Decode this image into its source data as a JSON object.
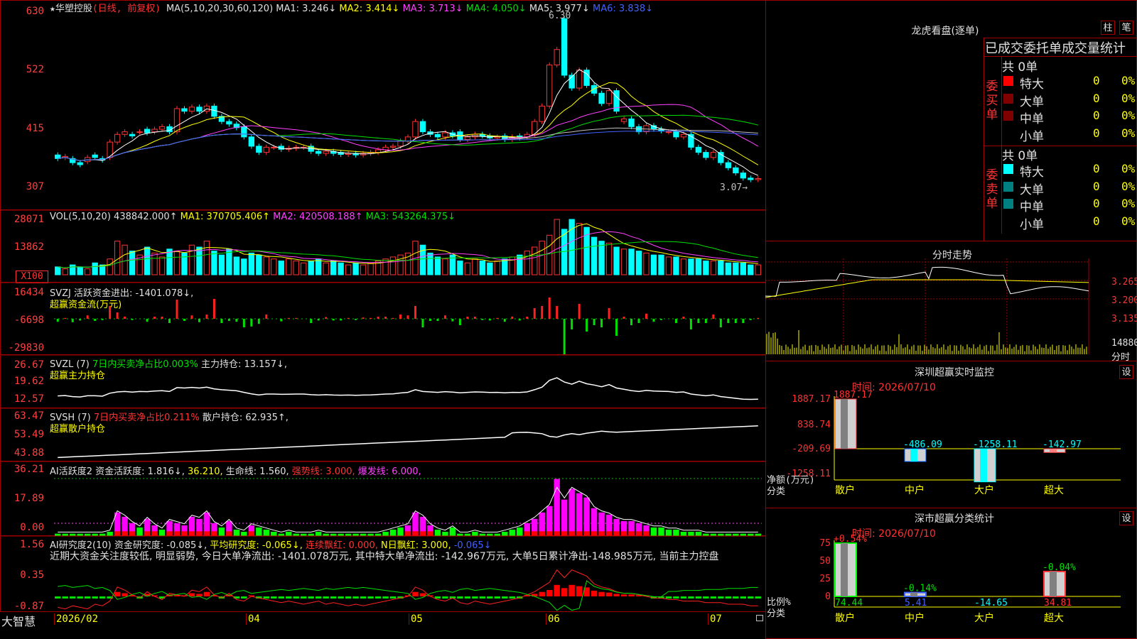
{
  "stock": {
    "title": "★华塑控股",
    "mode": "(日线, 前复权)",
    "ma_header": [
      {
        "t": "MA(5,10,20,30,60,120)",
        "c": "white"
      },
      {
        "t": "MA1: 3.246↓",
        "c": "white"
      },
      {
        "t": "MA2: 3.414↓",
        "c": "yel"
      },
      {
        "t": "MA3: 3.713↓",
        "c": "mag"
      },
      {
        "t": "MA4: 4.050↓",
        "c": "grn"
      },
      {
        "t": "MA5: 3.977↓",
        "c": "white"
      },
      {
        "t": "MA6: 3.838↓",
        "c": "blu"
      }
    ],
    "price_axis": [
      "630",
      "522",
      "415",
      "307"
    ],
    "peak_label": "6.30",
    "last_label": "3.07→"
  },
  "vol": {
    "header": [
      {
        "t": "VOL(5,10,20)",
        "c": "white"
      },
      {
        "t": "438842.000↑",
        "c": "white"
      },
      {
        "t": "MA1: 370705.406↑",
        "c": "yel"
      },
      {
        "t": "MA2: 420508.188↑",
        "c": "mag"
      },
      {
        "t": "MA3: 543264.375↓",
        "c": "grn"
      }
    ],
    "axis": [
      "28071",
      "13862"
    ],
    "unit": "X100"
  },
  "svzj": {
    "header": [
      {
        "t": "SVZJ  活跃资金进出: -1401.078↓,",
        "c": "white"
      }
    ],
    "sub": "超赢资金流(万元)",
    "axis": [
      "16434",
      "-6698",
      "-29830"
    ]
  },
  "svzl": {
    "header": [
      {
        "t": "SVZL (7)",
        "c": "white"
      },
      {
        "t": "7日内买卖净占比0.003%",
        "c": "grn"
      },
      {
        "t": "主力持仓: 13.157↓,",
        "c": "white"
      }
    ],
    "sub": "超赢主力持仓",
    "axis": [
      "26.67",
      "19.62",
      "12.57"
    ]
  },
  "svsh": {
    "header": [
      {
        "t": "SVSH (7)",
        "c": "white"
      },
      {
        "t": "7日内买卖净占比0.211%",
        "c": "red"
      },
      {
        "t": "散户持仓: 62.935↑,",
        "c": "white"
      }
    ],
    "sub": "超赢散户持仓",
    "axis": [
      "63.47",
      "53.49",
      "43.88"
    ]
  },
  "ai1": {
    "header": [
      {
        "t": "AI活跃度2",
        "c": "white"
      },
      {
        "t": "资金活跃度: 1.816↓,",
        "c": "white"
      },
      {
        "t": "36.210,",
        "c": "yel"
      },
      {
        "t": "生命线: 1.560,",
        "c": "white"
      },
      {
        "t": "强势线: 3.000,",
        "c": "red"
      },
      {
        "t": "爆发线: 6.000,",
        "c": "mag"
      }
    ],
    "axis": [
      "36.21",
      "17.89",
      "0.00"
    ]
  },
  "ai2": {
    "header": [
      {
        "t": "AI研究度2(10)",
        "c": "white"
      },
      {
        "t": "资金研究度: -0.085↓,",
        "c": "white"
      },
      {
        "t": "平均研究度: -0.065↓,",
        "c": "yel"
      },
      {
        "t": "连续飘红: 0.000,",
        "c": "red"
      },
      {
        "t": "N日飘红: 3.000,",
        "c": "yel"
      },
      {
        "t": "-0.065↓",
        "c": "blu"
      }
    ],
    "note": "近期大资金关注度较低, 明显弱势, 今日大单净流出: -1401.078万元, 其中特大单净流出: -142.967万元, 大单5日累计净出-148.985万元, 当前主力控盘",
    "axis": [
      "1.56",
      "0.35",
      "-0.87"
    ]
  },
  "date_axis": [
    "2026/02",
    "04",
    "05",
    "06",
    "07"
  ],
  "brand": "大智慧",
  "right": {
    "lhb_title": "龙虎看盘(逐单)",
    "btn_zhu": "柱",
    "btn_bi": "笔",
    "stat_title": "已成交委托单成交量统计",
    "buy_label": "委买单",
    "sell_label": "委卖单",
    "buy_total": "共 0单",
    "sell_total": "共 0单",
    "rows": [
      {
        "name": "特大",
        "val": "0",
        "pct": "0%"
      },
      {
        "name": "大单",
        "val": "0",
        "pct": "0%"
      },
      {
        "name": "中单",
        "val": "0",
        "pct": "0%"
      },
      {
        "name": "小单",
        "val": "0",
        "pct": "0%"
      }
    ],
    "intraday_title": "分时走势",
    "intraday_axis": [
      "3.265",
      "3.200",
      "3.135"
    ],
    "intraday_vol": "14880",
    "intraday_vol_label": "分时",
    "sz_title": "深圳超赢实时监控",
    "sz_time": "时间: 2026/07/10",
    "sz_axis": [
      "1887.17",
      "838.74",
      "-209.69",
      "-1258.11"
    ],
    "sz_ylabel": "净额(万元)",
    "sz_xlabel": "分类",
    "sz_cats": [
      "散户",
      "中户",
      "大户",
      "超大"
    ],
    "sz_vals": [
      "1887.17",
      "-486.09",
      "-1258.11",
      "-142.97"
    ],
    "cls_title": "深市超赢分类统计",
    "cls_time": "时间: 2026/07/10",
    "cls_axis": [
      "75",
      "50",
      "25",
      "0"
    ],
    "cls_ylabel": "比例%",
    "cls_xlabel": "分类",
    "cls_top": [
      "+0.54%",
      "-0.14%",
      "",
      "-0.04%"
    ],
    "cls_vals": [
      "74.44",
      "5.41",
      "-14.65",
      "34.81"
    ],
    "btn_set": "设"
  },
  "chart_data": {
    "type": "candlestick",
    "title": "华塑控股 (日线, 前复权)",
    "x_range": [
      "2026/02",
      "2026/07"
    ],
    "ylim": [
      3.07,
      6.3
    ],
    "candles": [
      [
        3.55,
        3.48
      ],
      [
        3.5,
        3.52
      ],
      [
        3.48,
        3.4
      ],
      [
        3.4,
        3.36
      ],
      [
        3.42,
        3.5
      ],
      [
        3.55,
        3.5
      ],
      [
        3.48,
        3.45
      ],
      [
        3.5,
        3.8
      ],
      [
        3.8,
        3.95
      ],
      [
        3.95,
        4.0
      ],
      [
        3.95,
        3.92
      ],
      [
        4.0,
        4.0
      ],
      [
        4.05,
        3.98
      ],
      [
        4.0,
        4.05
      ],
      [
        4.05,
        4.1
      ],
      [
        4.1,
        4.0
      ],
      [
        4.0,
        4.45
      ],
      [
        4.45,
        4.4
      ],
      [
        4.4,
        4.48
      ],
      [
        4.48,
        4.4
      ],
      [
        4.4,
        4.5
      ],
      [
        4.5,
        4.3
      ],
      [
        4.3,
        4.2
      ],
      [
        4.2,
        4.15
      ],
      [
        4.15,
        4.08
      ],
      [
        4.1,
        3.9
      ],
      [
        3.9,
        3.72
      ],
      [
        3.72,
        3.6
      ],
      [
        3.6,
        3.7
      ],
      [
        3.7,
        3.7
      ],
      [
        3.72,
        3.66
      ],
      [
        3.66,
        3.68
      ],
      [
        3.68,
        3.7
      ],
      [
        3.7,
        3.7
      ],
      [
        3.72,
        3.62
      ],
      [
        3.62,
        3.58
      ],
      [
        3.58,
        3.62
      ],
      [
        3.62,
        3.58
      ],
      [
        3.6,
        3.56
      ],
      [
        3.56,
        3.58
      ],
      [
        3.58,
        3.55
      ],
      [
        3.55,
        3.58
      ],
      [
        3.58,
        3.6
      ],
      [
        3.6,
        3.65
      ],
      [
        3.65,
        3.7
      ],
      [
        3.7,
        3.72
      ],
      [
        3.72,
        3.82
      ],
      [
        3.82,
        3.9
      ],
      [
        3.9,
        4.2
      ],
      [
        4.2,
        4.0
      ],
      [
        4.0,
        3.95
      ],
      [
        3.95,
        3.9
      ],
      [
        3.9,
        3.98
      ],
      [
        3.98,
        3.92
      ],
      [
        4.0,
        3.85
      ],
      [
        3.85,
        3.9
      ],
      [
        3.9,
        3.95
      ],
      [
        3.95,
        3.92
      ],
      [
        3.92,
        3.88
      ],
      [
        3.88,
        3.9
      ],
      [
        3.92,
        3.85
      ],
      [
        3.85,
        3.9
      ],
      [
        3.92,
        3.88
      ],
      [
        3.9,
        3.95
      ],
      [
        3.95,
        4.2
      ],
      [
        4.2,
        4.5
      ],
      [
        4.5,
        5.3
      ],
      [
        5.3,
        5.6
      ],
      [
        6.2,
        5.1
      ],
      [
        5.1,
        4.85
      ],
      [
        4.85,
        5.2
      ],
      [
        5.2,
        4.9
      ],
      [
        4.9,
        4.75
      ],
      [
        4.75,
        4.55
      ],
      [
        4.55,
        4.8
      ],
      [
        4.8,
        4.4
      ],
      [
        4.2,
        4.25
      ],
      [
        4.25,
        4.1
      ],
      [
        4.1,
        4.0
      ],
      [
        4.0,
        4.12
      ],
      [
        4.12,
        4.05
      ],
      [
        4.05,
        4.02
      ],
      [
        4.0,
        4.0
      ],
      [
        4.0,
        3.9
      ],
      [
        3.9,
        3.95
      ],
      [
        3.95,
        3.7
      ],
      [
        3.7,
        3.6
      ],
      [
        3.6,
        3.5
      ],
      [
        3.5,
        3.6
      ],
      [
        3.6,
        3.4
      ],
      [
        3.4,
        3.3
      ],
      [
        3.3,
        3.2
      ],
      [
        3.2,
        3.1
      ],
      [
        3.1,
        3.07
      ],
      [
        3.07,
        3.09
      ]
    ],
    "vol_values": [
      4,
      3,
      5,
      4,
      3,
      6,
      5,
      8,
      17,
      15,
      12,
      10,
      14,
      11,
      9,
      13,
      12,
      11,
      15,
      14,
      17,
      12,
      10,
      13,
      9,
      8,
      11,
      10,
      9,
      8,
      7,
      8,
      7,
      6,
      7,
      8,
      6,
      7,
      6,
      5,
      6,
      5,
      6,
      7,
      8,
      9,
      10,
      11,
      17,
      15,
      11,
      9,
      8,
      10,
      7,
      6,
      8,
      7,
      6,
      7,
      8,
      9,
      10,
      12,
      14,
      17,
      20,
      28,
      23,
      28,
      26,
      24,
      19,
      17,
      16,
      14,
      13,
      13,
      12,
      11,
      10,
      10,
      9,
      9,
      8,
      8,
      8,
      7,
      7,
      7,
      6,
      6,
      6,
      5,
      5
    ]
  }
}
